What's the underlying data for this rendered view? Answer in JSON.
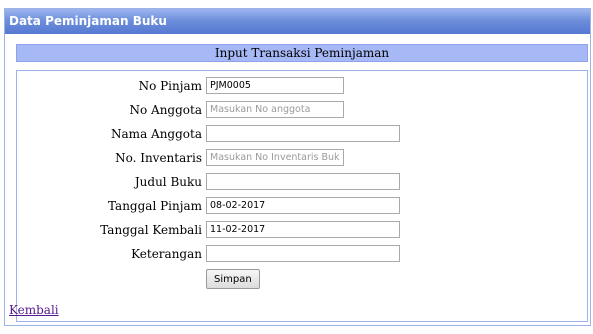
{
  "panel": {
    "title": "Data Peminjaman Buku"
  },
  "form": {
    "section_title": "Input Transaksi Peminjaman",
    "fields": [
      {
        "label": "No Pinjam",
        "value": "PJM0005",
        "placeholder": ""
      },
      {
        "label": "No Anggota",
        "value": "",
        "placeholder": "Masukan No anggota"
      },
      {
        "label": "Nama Anggota",
        "value": "",
        "placeholder": ""
      },
      {
        "label": "No. Inventaris",
        "value": "",
        "placeholder": "Masukan No Inventaris Buku"
      },
      {
        "label": "Judul Buku",
        "value": "",
        "placeholder": ""
      },
      {
        "label": "Tanggal Pinjam",
        "value": "08-02-2017",
        "placeholder": ""
      },
      {
        "label": "Tanggal Kembali",
        "value": "11-02-2017",
        "placeholder": ""
      },
      {
        "label": "Keterangan",
        "value": "",
        "placeholder": ""
      }
    ],
    "submit_label": "Simpan"
  },
  "back_link": "Kembali"
}
